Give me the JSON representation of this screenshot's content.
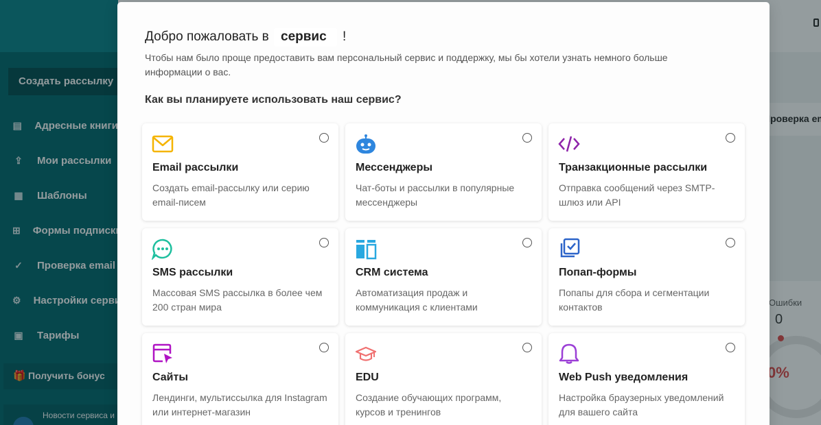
{
  "background": {
    "sidebar": {
      "create_button": "Создать рассылку",
      "items": [
        {
          "icon": "address-book-icon",
          "label": "Адресные книги"
        },
        {
          "icon": "upload-icon",
          "label": "Мои рассылки"
        },
        {
          "icon": "template-icon",
          "label": "Шаблоны"
        },
        {
          "icon": "form-icon",
          "label": "Формы подписки"
        },
        {
          "icon": "check-icon",
          "label": "Проверка email"
        },
        {
          "icon": "settings-icon",
          "label": "Настройки сервиса"
        },
        {
          "icon": "wallet-icon",
          "label": "Тарифы"
        }
      ],
      "bonus_label": "Получить бонус",
      "news_label": "Новости сервиса и"
    },
    "right_panel": {
      "tab_label": "Проверка email",
      "errors_label": "Ошибки",
      "errors_value": "0",
      "gauge_value": "0%"
    }
  },
  "modal": {
    "title_prefix": "Добро пожаловать в",
    "service_name": "сервис",
    "title_suffix": "!",
    "intro": "Чтобы нам было проще предоставить вам персональный сервис и поддержку, мы бы хотели узнать немного больше информации о вас.",
    "question": "Как вы планируете использовать наш сервис?",
    "options": [
      {
        "icon": "envelope-icon",
        "color": "#f5b400",
        "title": "Email рассылки",
        "description": "Создать email-рассылку или серию email-писем",
        "selected": false
      },
      {
        "icon": "bot-icon",
        "color": "#2e86de",
        "title": "Мессенджеры",
        "description": "Чат-боты и рассылки в популярные мессенджеры",
        "selected": false
      },
      {
        "icon": "code-icon",
        "color": "#8e24aa",
        "title": "Транзакционные рассылки",
        "description": "Отправка сообщений через SMTP-шлюз или API",
        "selected": false
      },
      {
        "icon": "chat-bubble-icon",
        "color": "#1ebf9e",
        "title": "SMS рассылки",
        "description": "Массовая SMS рассылка в более чем 200 стран мира",
        "selected": false
      },
      {
        "icon": "crm-columns-icon",
        "color": "#29a8e0",
        "title": "CRM система",
        "description": "Автоматизация продаж и коммуникация с клиентами",
        "selected": false
      },
      {
        "icon": "popup-check-icon",
        "color": "#2c64c9",
        "title": "Попап-формы",
        "description": "Попапы для сбора и сегментации контактов",
        "selected": false
      },
      {
        "icon": "website-cursor-icon",
        "color": "#b014c4",
        "title": "Сайты",
        "description": "Лендинги, мультиссылка для Instagram или интернет-магазин",
        "selected": false
      },
      {
        "icon": "graduation-cap-icon",
        "color": "#f07070",
        "title": "EDU",
        "description": "Создание обучающих программ, курсов и тренингов",
        "selected": false
      },
      {
        "icon": "bell-icon",
        "color": "#9b3fd6",
        "title": "Web Push уведомления",
        "description": "Настройка браузерных уведомлений для вашего сайта",
        "selected": false
      }
    ]
  }
}
